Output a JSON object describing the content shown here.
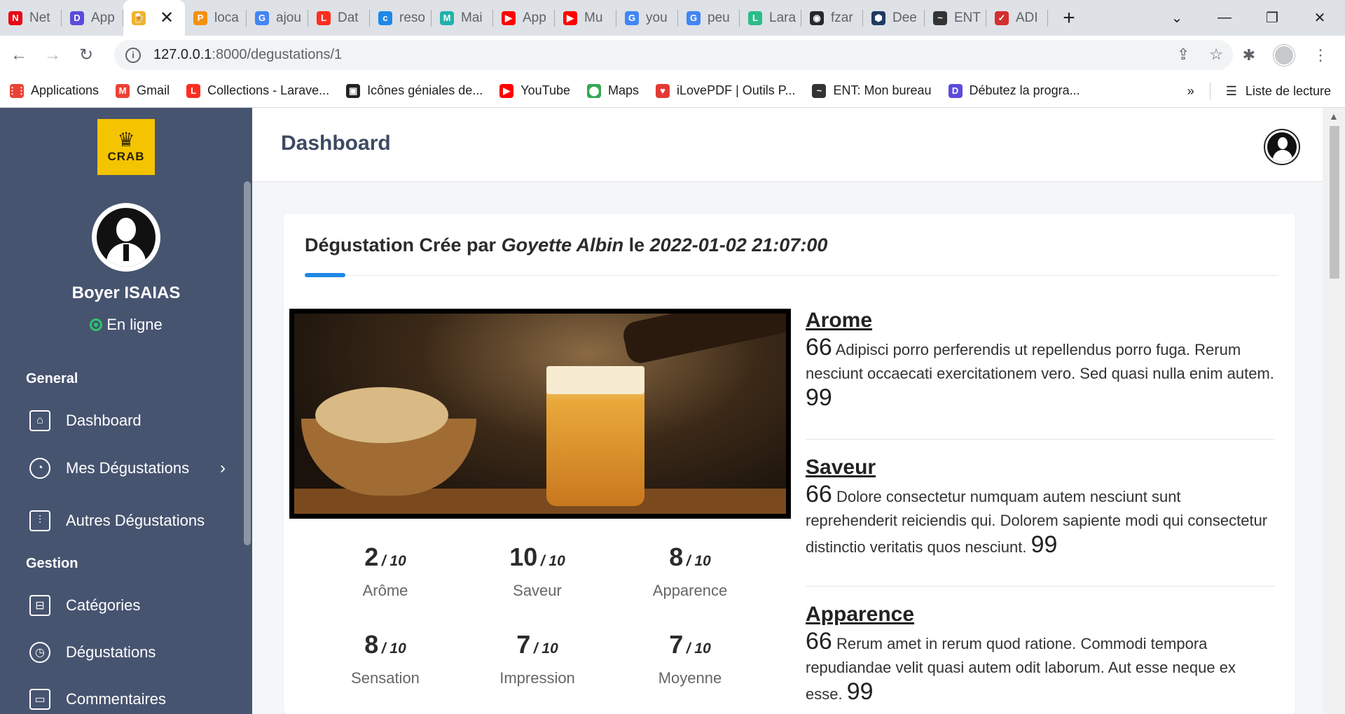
{
  "browser": {
    "tabs": [
      {
        "label": "Net",
        "color": "#e50914",
        "glyph": "N"
      },
      {
        "label": "App",
        "color": "#5b4bdb",
        "glyph": "D"
      },
      {
        "label": "",
        "color": "#f0b429",
        "glyph": "🍺",
        "active": true
      },
      {
        "label": "loca",
        "color": "#f29111",
        "glyph": "P"
      },
      {
        "label": "ajou",
        "color": "#4285f4",
        "glyph": "G"
      },
      {
        "label": "Dat",
        "color": "#ff2d20",
        "glyph": "L"
      },
      {
        "label": "reso",
        "color": "#1e88e5",
        "glyph": "c"
      },
      {
        "label": "Mai",
        "color": "#20b2aa",
        "glyph": "M"
      },
      {
        "label": "App",
        "color": "#ff0000",
        "glyph": "▶"
      },
      {
        "label": "Mu",
        "color": "#ff0000",
        "glyph": "▶"
      },
      {
        "label": "you",
        "color": "#4285f4",
        "glyph": "G"
      },
      {
        "label": "peu",
        "color": "#4285f4",
        "glyph": "G"
      },
      {
        "label": "Lara",
        "color": "#2bbc8a",
        "glyph": "L"
      },
      {
        "label": "fzar",
        "color": "#24292e",
        "glyph": "◉"
      },
      {
        "label": "Dee",
        "color": "#1f3a5f",
        "glyph": "⬢"
      },
      {
        "label": "ENT",
        "color": "#333333",
        "glyph": "~"
      },
      {
        "label": "ADI",
        "color": "#d32f2f",
        "glyph": "✓"
      }
    ],
    "close_glyph": "✕",
    "new_tab_glyph": "+",
    "url_host": "127.0.0.1",
    "url_path": ":8000/degustations/1",
    "bookmarks": [
      {
        "label": "Applications",
        "color": "#ea4335",
        "glyph": "⋮⋮"
      },
      {
        "label": "Gmail",
        "color": "#ea4335",
        "glyph": "M"
      },
      {
        "label": "Collections - Larave...",
        "color": "#ff2d20",
        "glyph": "L"
      },
      {
        "label": "Icônes géniales de...",
        "color": "#222222",
        "glyph": "▣"
      },
      {
        "label": "YouTube",
        "color": "#ff0000",
        "glyph": "▶"
      },
      {
        "label": "Maps",
        "color": "#34a853",
        "glyph": "⬤"
      },
      {
        "label": "iLovePDF | Outils P...",
        "color": "#e53935",
        "glyph": "♥"
      },
      {
        "label": "ENT: Mon bureau",
        "color": "#333333",
        "glyph": "~"
      },
      {
        "label": "Débutez la progra...",
        "color": "#5b4bdb",
        "glyph": "D"
      }
    ],
    "bookmarks_more": "»",
    "reading_list": "Liste de lecture"
  },
  "sidebar": {
    "logo_text": "CRAB",
    "user_name": "Boyer ISAIAS",
    "status": "En ligne",
    "section_general": "General",
    "section_gestion": "Gestion",
    "items": [
      {
        "label": "Dashboard",
        "icon": "home-icon"
      },
      {
        "label": "Mes Dégustations",
        "icon": "palette-icon"
      },
      {
        "label": "Autres Dégustations",
        "icon": "sliders-icon"
      },
      {
        "label": "Catégories",
        "icon": "signpost-icon"
      },
      {
        "label": "Dégustations",
        "icon": "pie-chart-icon"
      },
      {
        "label": "Commentaires",
        "icon": "comment-icon"
      }
    ]
  },
  "header": {
    "title": "Dashboard"
  },
  "card": {
    "title_prefix": "Dégustation Crée par",
    "author": "Goyette Albin",
    "title_mid": "le",
    "date": "2022-01-02 21:07:00",
    "scores": [
      {
        "value": "2",
        "max": "/ 10",
        "label": "Arôme"
      },
      {
        "value": "10",
        "max": "/ 10",
        "label": "Saveur"
      },
      {
        "value": "8",
        "max": "/ 10",
        "label": "Apparence"
      },
      {
        "value": "8",
        "max": "/ 10",
        "label": "Sensation"
      },
      {
        "value": "7",
        "max": "/ 10",
        "label": "Impression"
      },
      {
        "value": "7",
        "max": "/ 10",
        "label": "Moyenne"
      }
    ],
    "criteria": [
      {
        "name": "Arome",
        "open": "66",
        "text": "Adipisci porro perferendis ut repellendus porro fuga. Rerum nesciunt occaecati exercitationem vero. Sed quasi nulla enim autem.",
        "close": "99"
      },
      {
        "name": "Saveur",
        "open": "66",
        "text": "Dolore consectetur numquam autem nesciunt sunt reprehenderit reiciendis qui. Dolorem sapiente modi qui consectetur distinctio veritatis quos nesciunt.",
        "close": "99"
      },
      {
        "name": "Apparence",
        "open": "66",
        "text": "Rerum amet in rerum quod ratione. Commodi tempora repudiandae velit quasi autem odit laborum. Aut esse neque ex esse.",
        "close": "99"
      }
    ]
  }
}
